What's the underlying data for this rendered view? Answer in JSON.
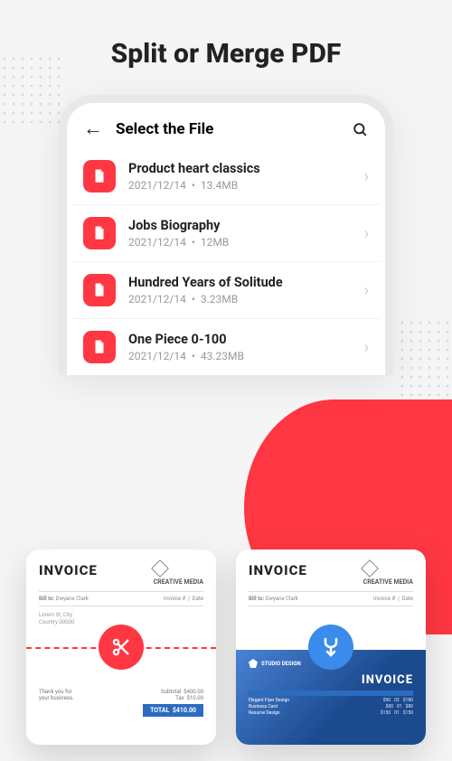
{
  "headline": "Split or Merge PDF",
  "screen": {
    "title": "Select the File"
  },
  "files": [
    {
      "name": "Product heart classics",
      "date": "2021/12/14",
      "size": "13.4MB"
    },
    {
      "name": "Jobs Biography",
      "date": "2021/12/14",
      "size": "12MB"
    },
    {
      "name": "Hundred Years of Solitude",
      "date": "2021/12/14",
      "size": "3.23MB"
    },
    {
      "name": "One Piece 0-100",
      "date": "2021/12/14",
      "size": "43.23MB"
    }
  ],
  "preview": {
    "invoice_label": "INVOICE",
    "company": "CREATIVE MEDIA",
    "billto_label": "Bill to:",
    "billto_name": "Dwyane Clark",
    "studio": "STUDIO DESIGN",
    "total_label": "TOTAL",
    "total_value": "$410.00"
  }
}
